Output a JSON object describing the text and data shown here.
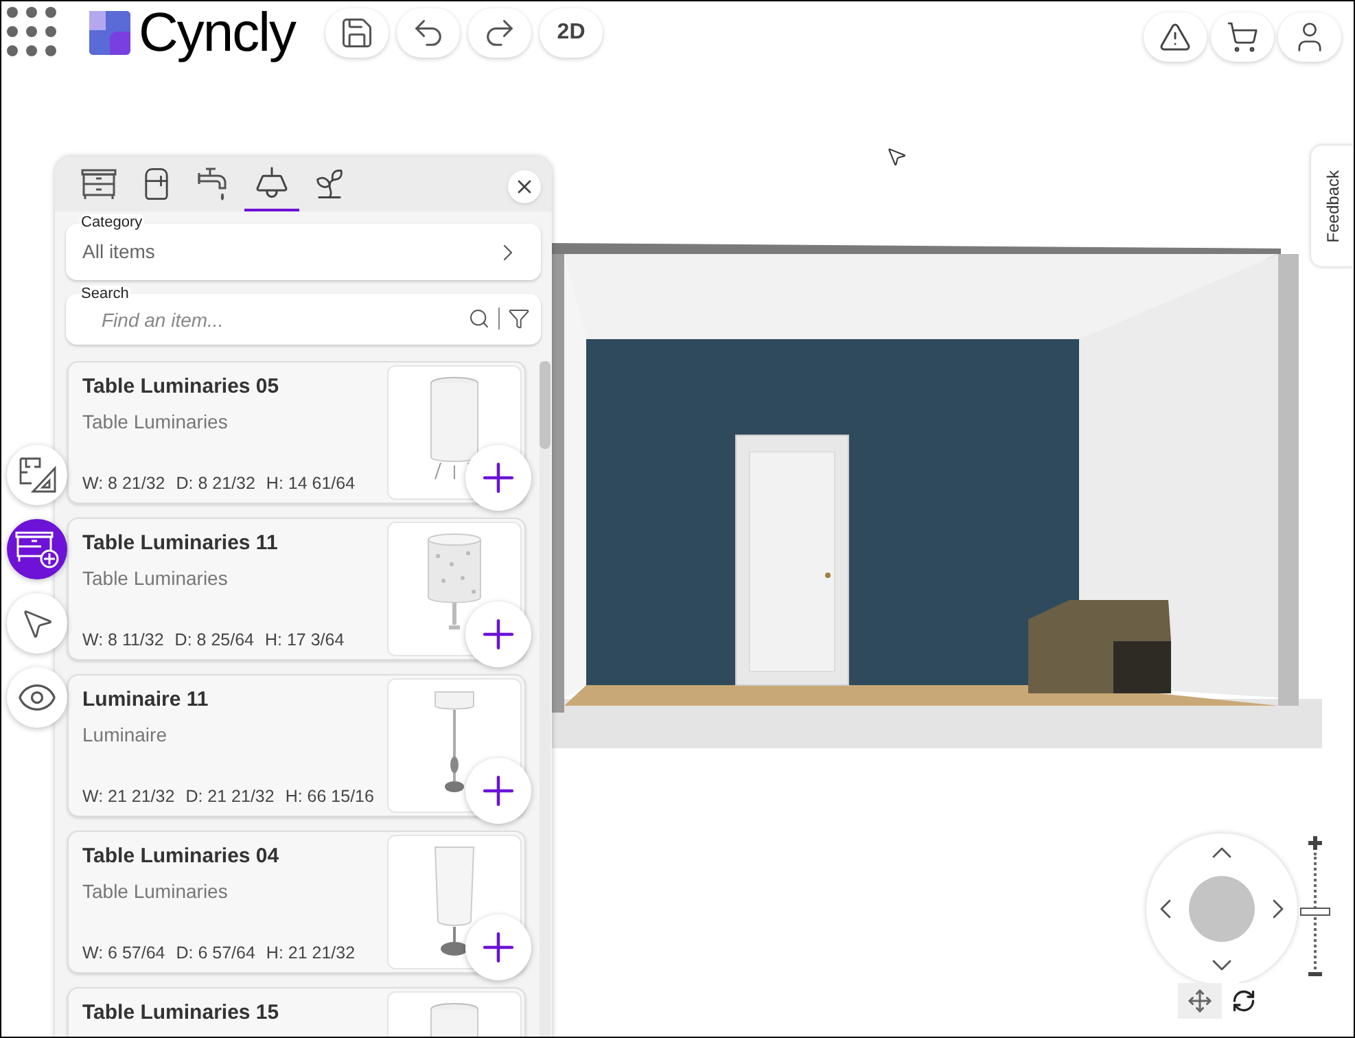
{
  "header": {
    "logo": "Cyncly",
    "view_toggle": "2D"
  },
  "feedback": "Feedback",
  "panel": {
    "tabs": [
      {
        "kind": "cabinet",
        "selected": false
      },
      {
        "kind": "appliance",
        "selected": false
      },
      {
        "kind": "faucet",
        "selected": false
      },
      {
        "kind": "lamp",
        "selected": true
      },
      {
        "kind": "plant",
        "selected": false
      }
    ],
    "category": {
      "label": "Category",
      "value": "All items"
    },
    "search": {
      "label": "Search",
      "placeholder": "Find an item..."
    },
    "items": [
      {
        "name": "Table Luminaries 05",
        "category": "Table Luminaries",
        "dims": [
          "W: 8 21/32",
          "D: 8 21/32",
          "H: 14 61/64"
        ],
        "kind": "cylinder"
      },
      {
        "name": "Table Luminaries 11",
        "category": "Table Luminaries",
        "dims": [
          "W: 8 11/32",
          "D: 8 25/64",
          "H: 17 3/64"
        ],
        "kind": "drum"
      },
      {
        "name": "Luminaire 11",
        "category": "Luminaire",
        "dims": [
          "W: 21 21/32",
          "D: 21 21/32",
          "H: 66 15/16"
        ],
        "kind": "floor"
      },
      {
        "name": "Table Luminaries 04",
        "category": "Table Luminaries",
        "dims": [
          "W: 6 57/64",
          "D: 6 57/64",
          "H: 21 21/32"
        ],
        "kind": "tall"
      },
      {
        "name": "Table Luminaries 15",
        "kind": "cylinder"
      }
    ]
  },
  "tool_rail": [
    {
      "kind": "plan",
      "selected": false
    },
    {
      "kind": "add",
      "selected": true
    },
    {
      "kind": "select",
      "selected": false
    },
    {
      "kind": "view",
      "selected": false
    }
  ],
  "navigation": {
    "modes": [
      {
        "kind": "move",
        "selected": true
      },
      {
        "kind": "rotate",
        "selected": false
      }
    ],
    "zoom": {
      "level": 0.5
    }
  }
}
